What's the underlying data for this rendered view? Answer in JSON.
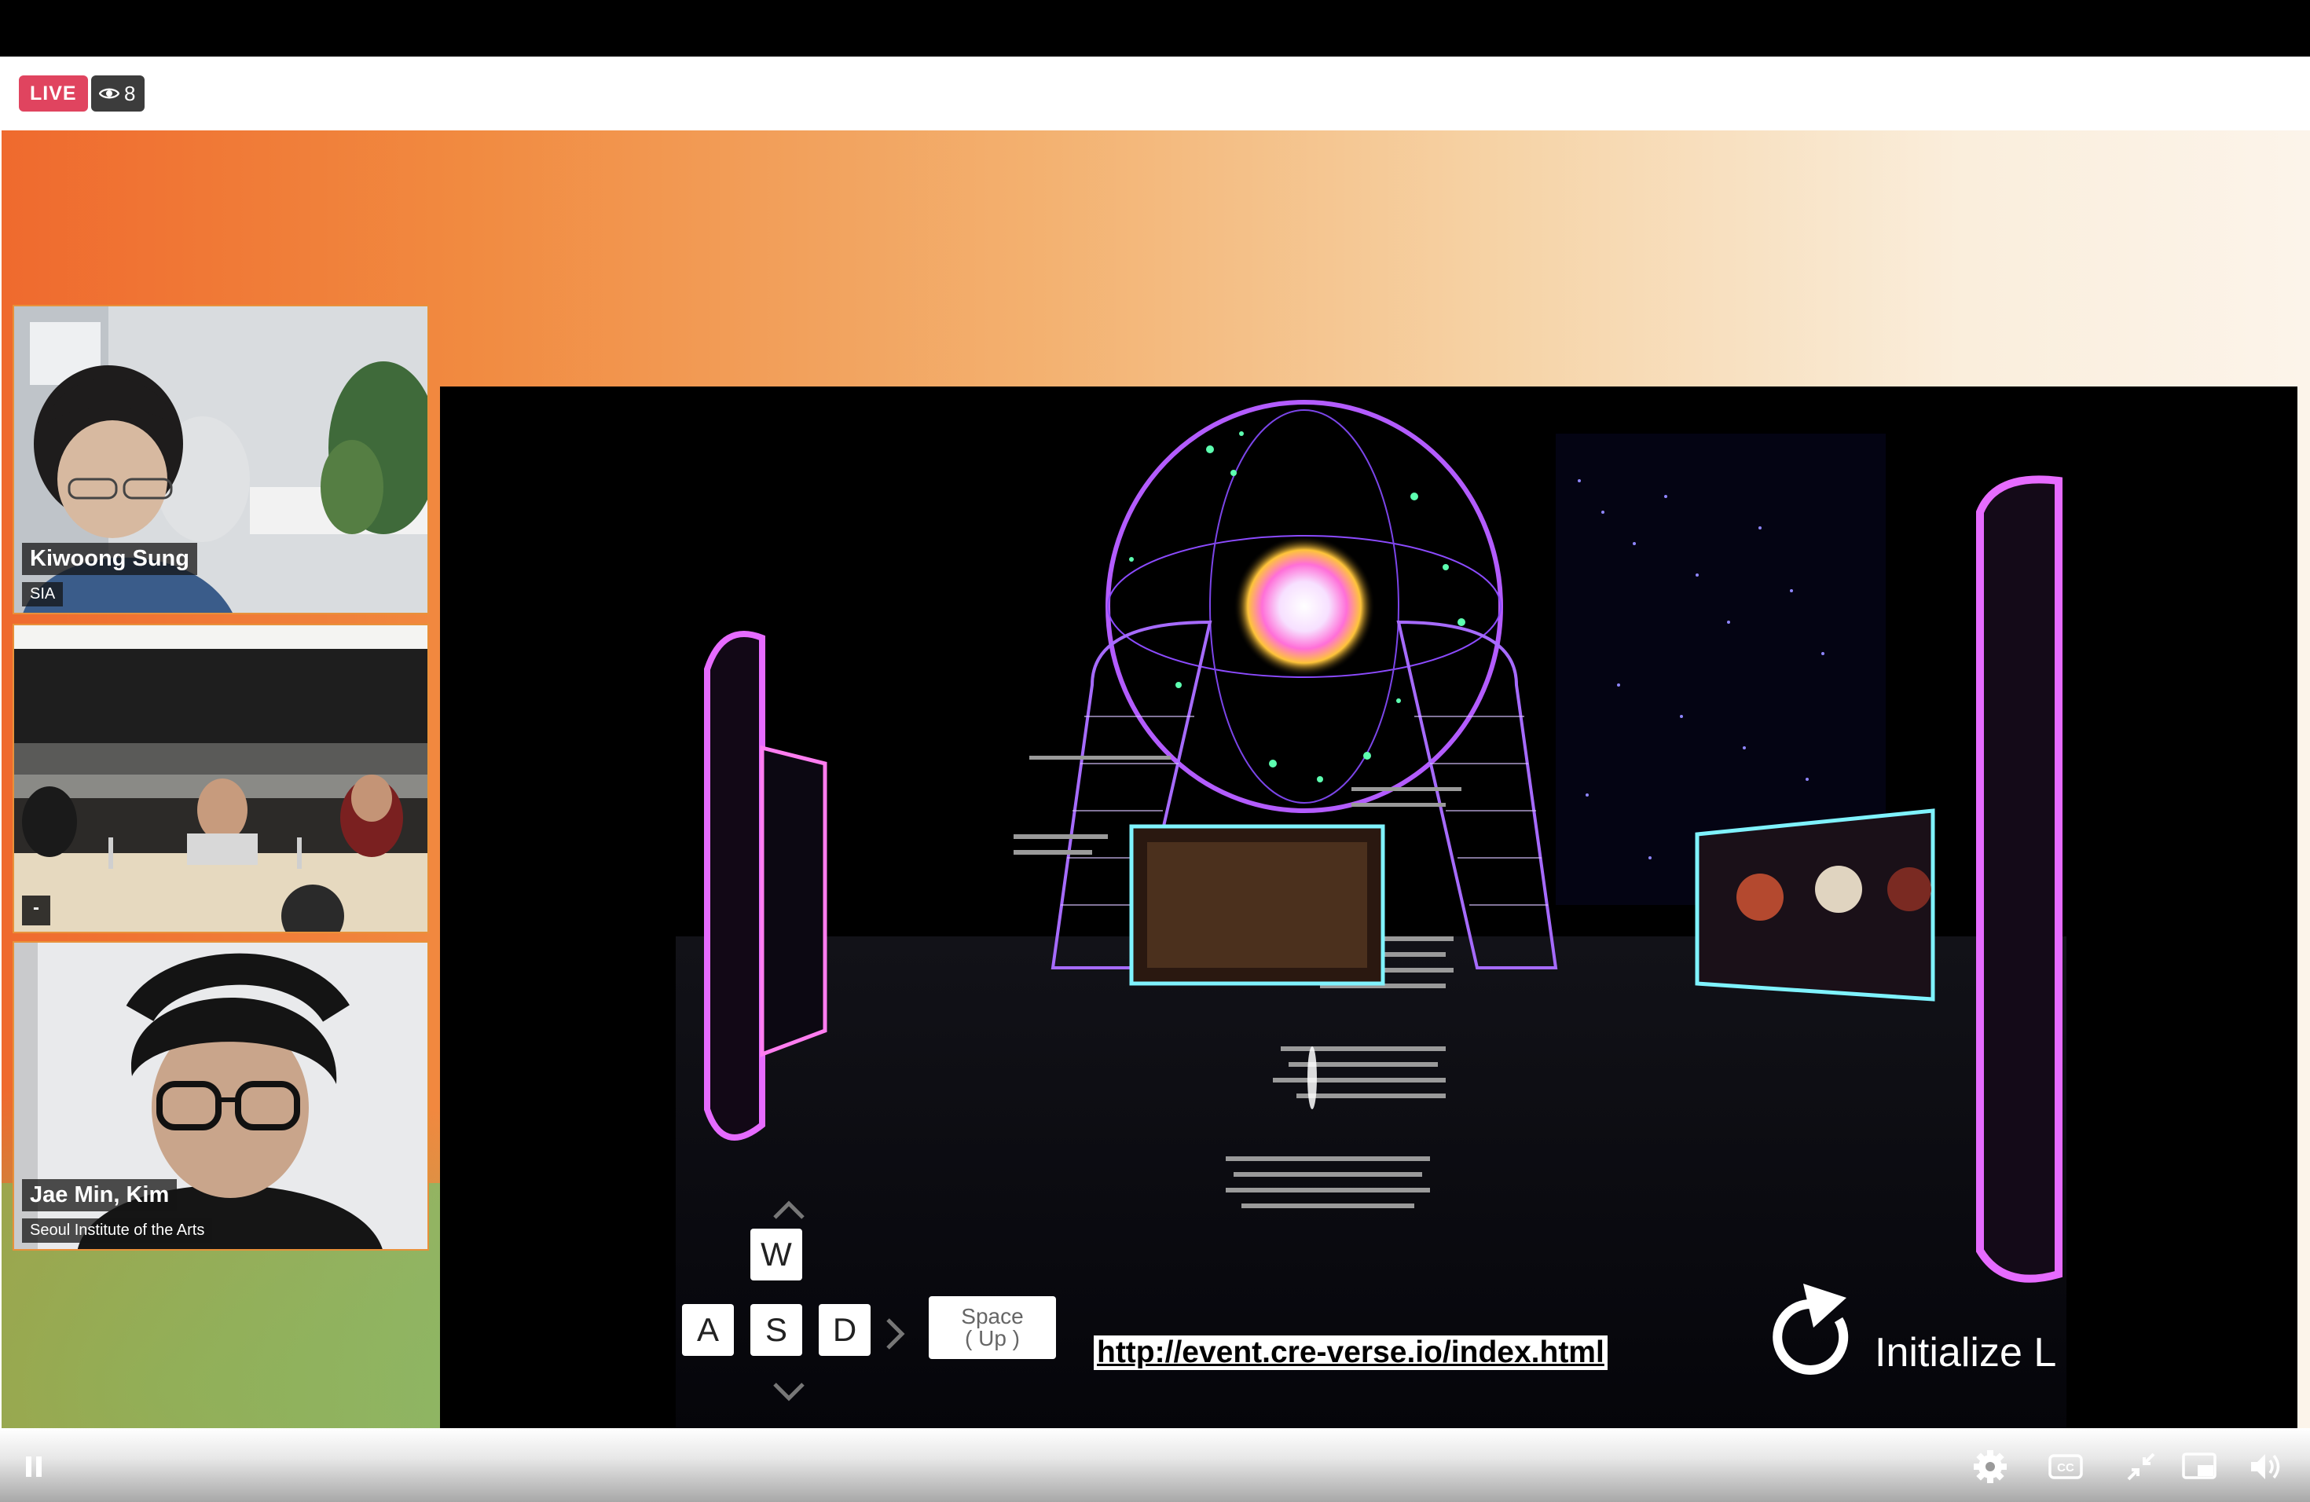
{
  "stream": {
    "live_label": "LIVE",
    "viewer_count": "8"
  },
  "participants": [
    {
      "name": "Kiwoong Sung",
      "org": "SIA"
    },
    {
      "name": "",
      "org": "-"
    },
    {
      "name": "Jae Min, Kim",
      "org": "Seoul Institute of the Arts"
    }
  ],
  "shared_screen": {
    "keys": [
      "W",
      "A",
      "S",
      "D"
    ],
    "space_key": {
      "line1": "Space",
      "line2": "( Up )"
    },
    "url": "http://event.cre-verse.io/index.html",
    "initialize_label": "Initialize L"
  },
  "player_controls": {
    "icons": [
      "pause-icon",
      "gear-icon",
      "closed-captions-icon",
      "exit-fullscreen-icon",
      "picture-in-picture-icon",
      "volume-icon"
    ]
  },
  "colors": {
    "live_badge": "#e0445f",
    "tile_border": "#e8913a",
    "neon_purple": "#c04bff",
    "neon_cyan": "#7ff3ff"
  }
}
